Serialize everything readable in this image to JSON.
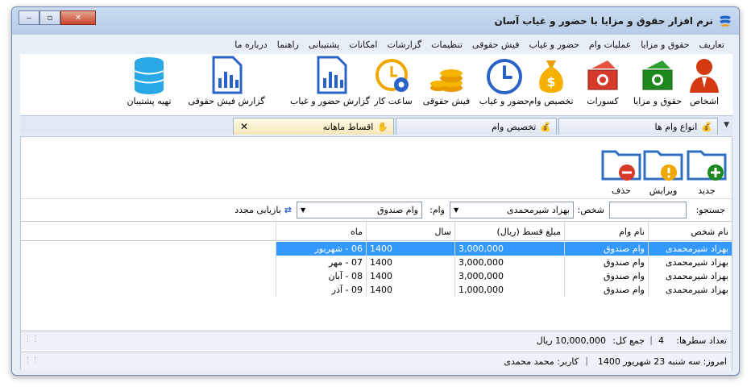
{
  "window": {
    "title": "نرم افزار حقوق و مزایا با حضور و غیاب آسان"
  },
  "menu": [
    "تعاریف",
    "حقوق و مزایا",
    "عملیات وام",
    "حضور و غیاب",
    "فیش حقوقی",
    "تنظیمات",
    "گزارشات",
    "امکانات",
    "پشتیبانی",
    "راهنما",
    "درباره ما"
  ],
  "toolbar": [
    {
      "label": "اشخاص",
      "icon": "person-icon"
    },
    {
      "label": "حقوق و مزایا",
      "icon": "money-icon"
    },
    {
      "label": "کسورات",
      "icon": "money-minus-icon"
    },
    {
      "label": "تخصیص وام",
      "icon": "money-bag-icon"
    },
    {
      "label": "حضور و غیاب",
      "icon": "clock-icon"
    },
    {
      "label": "فیش حقوقی",
      "icon": "coins-icon"
    },
    {
      "label": "ساعت کار",
      "icon": "clock-gear-icon"
    },
    {
      "label": "گزارش حضور و غیاب",
      "icon": "report-icon"
    },
    {
      "label": "گزارش فیش حقوقی",
      "icon": "report-icon"
    },
    {
      "label": "تهیه پشتیبان",
      "icon": "database-icon"
    }
  ],
  "tabs": [
    {
      "label": "انواع وام ها"
    },
    {
      "label": "تخصیص وام"
    },
    {
      "label": "اقساط ماهانه"
    }
  ],
  "actions": {
    "new": "جدید",
    "edit": "ویرایش",
    "delete": "حذف"
  },
  "filters": {
    "search_label": "جستجو:",
    "search_value": "",
    "person_label": "شخص:",
    "person_value": "بهزاد شیرمحمدی",
    "loan_label": "وام:",
    "loan_value": "وام صندوق",
    "refresh_label": "بازیابی مجدد"
  },
  "table": {
    "headers": [
      "نام شخص",
      "نام وام",
      "مبلغ قسط (ریال)",
      "سال",
      "ماه"
    ],
    "rows": [
      [
        "بهزاد شیرمحمدی",
        "وام صندوق",
        "3,000,000",
        "1400",
        "06 - شهریور"
      ],
      [
        "بهزاد شیرمحمدی",
        "وام صندوق",
        "3,000,000",
        "1400",
        "07 - مهر"
      ],
      [
        "بهزاد شیرمحمدی",
        "وام صندوق",
        "3,000,000",
        "1400",
        "08 - آبان"
      ],
      [
        "بهزاد شیرمحمدی",
        "وام صندوق",
        "1,000,000",
        "1400",
        "09 - آذر"
      ]
    ]
  },
  "summary": {
    "rows_label": "تعداد سطرها:",
    "rows_count": "4",
    "total_label": "جمع کل:",
    "total_value": "10,000,000 ریال"
  },
  "status": {
    "today": "امروز: سه شنبه 23 شهریور 1400",
    "user": "کاربر: محمد محمدی"
  },
  "colors": {
    "accent": "#3399ff",
    "folder": "#2f6fc2"
  }
}
